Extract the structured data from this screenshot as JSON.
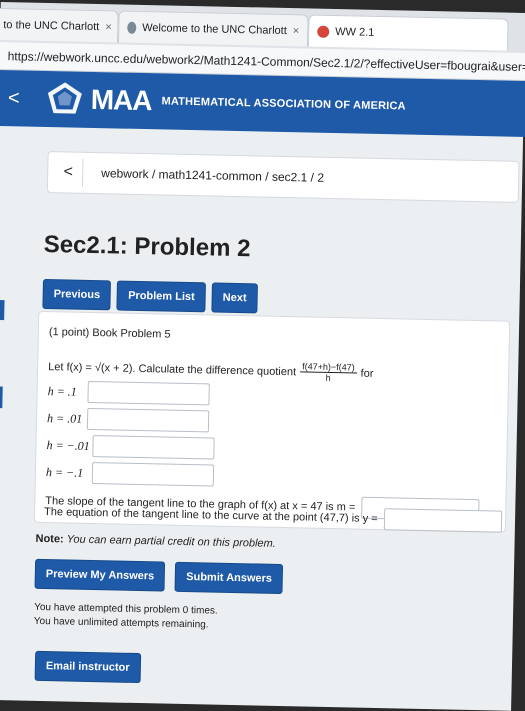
{
  "browser": {
    "tabs": [
      {
        "title": "to the UNC Charlott",
        "close": "×"
      },
      {
        "title": "Welcome to the UNC Charlott",
        "close": "×"
      },
      {
        "title": "WW 2.1",
        "close": ""
      }
    ],
    "url": "https://webwork.uncc.edu/webwork2/Math1241-Common/Sec2.1/2/?effectiveUser=fbougrai&user="
  },
  "site": {
    "brand": "MAA",
    "subtitle": "MATHEMATICAL ASSOCIATION OF AMERICA",
    "back": "<"
  },
  "breadcrumb": {
    "back": "<",
    "text": "webwork / math1241-common / sec2.1 / 2"
  },
  "page": {
    "title": "Sec2.1: Problem 2"
  },
  "nav": {
    "previous": "Previous",
    "problem_list": "Problem List",
    "next": "Next"
  },
  "problem": {
    "header": "(1 point) Book Problem 5",
    "intro_prefix": "Let f(x) = √(x + 2). Calculate the difference quotient",
    "frac_num": "f(47+h)−f(47)",
    "frac_den": "h",
    "intro_suffix": "for",
    "h_values": [
      "h = .1",
      "h = .01",
      "h = −.01",
      "h = −.1"
    ],
    "slope_text": "The slope of the tangent line to the graph of f(x) at x = 47 is m =",
    "equation_text": "The equation of the tangent line to the curve at the point (47,7) is y ="
  },
  "note": {
    "label": "Note:",
    "text": "You can earn partial credit on this problem."
  },
  "actions": {
    "preview": "Preview My Answers",
    "submit": "Submit Answers"
  },
  "status": {
    "attempted": "You have attempted this problem 0 times.",
    "remaining": "You have unlimited attempts remaining."
  },
  "email": {
    "label": "Email instructor"
  }
}
